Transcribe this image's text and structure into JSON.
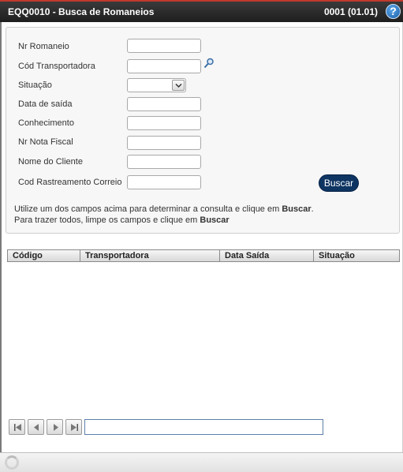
{
  "header": {
    "title": "EQQ0010 - Busca de Romaneios",
    "version": "0001 (01.01)",
    "help_label": "?"
  },
  "form": {
    "fields": [
      {
        "label": "Nr Romaneio",
        "value": ""
      },
      {
        "label": "Cód Transportadora",
        "value": ""
      },
      {
        "label": "Situação",
        "value": ""
      },
      {
        "label": "Data de saída",
        "value": ""
      },
      {
        "label": "Conhecimento",
        "value": ""
      },
      {
        "label": "Nr Nota Fiscal",
        "value": ""
      },
      {
        "label": "Nome do Cliente",
        "value": ""
      },
      {
        "label": "Cod Rastreamento Correio",
        "value": ""
      }
    ],
    "search_button": "Buscar",
    "help_line1_pre": "Utilize um dos campos acima para determinar a consulta e clique em ",
    "help_line1_bold": "Buscar",
    "help_line1_post": ".",
    "help_line2_pre": "Para trazer todos, limpe os campos e clique em ",
    "help_line2_bold": "Buscar"
  },
  "grid": {
    "columns": [
      "Código",
      "Transportadora",
      "Data Saída",
      "Situação"
    ],
    "rows": []
  },
  "pager": {
    "info": ""
  },
  "icons": {
    "lookup": "magnifier-icon",
    "first": "first-page-icon",
    "prev": "prev-page-icon",
    "next": "next-page-icon",
    "last": "last-page-icon",
    "status": "spinner-icon"
  },
  "colors": {
    "header_bg": "#2a2a2a",
    "button_bg": "#0e3462",
    "help_icon": "#1c5fa8"
  }
}
